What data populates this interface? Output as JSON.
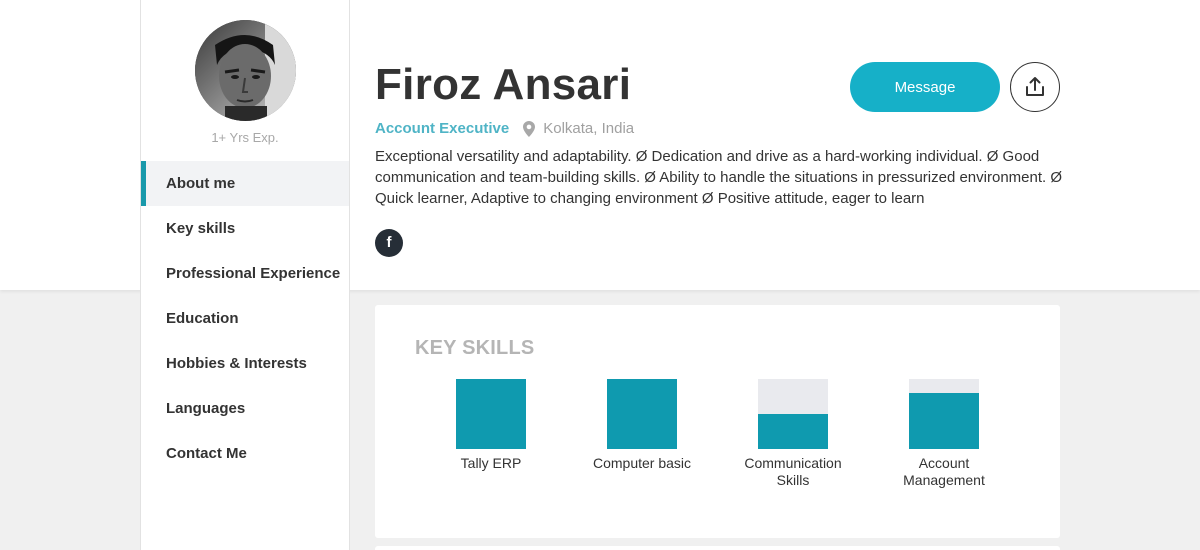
{
  "profile": {
    "name": "Firoz Ansari",
    "job_title": "Account Executive",
    "location": "Kolkata, India",
    "experience": "1+ Yrs Exp.",
    "bio": "Exceptional versatility and adaptability. Ø Dedication and drive as a hard-working individual. Ø Good communication and team-building skills. Ø Ability to handle the situations in pressurized environment. Ø Quick learner, Adaptive to changing environment Ø Positive attitude, eager to learn",
    "facebook_glyph": "f"
  },
  "actions": {
    "message_label": "Message",
    "share_icon": "share-upload-icon"
  },
  "nav": {
    "items": [
      {
        "label": "About me",
        "active": true
      },
      {
        "label": "Key skills"
      },
      {
        "label": "Professional Experience"
      },
      {
        "label": "Education"
      },
      {
        "label": "Hobbies & Interests"
      },
      {
        "label": "Languages"
      },
      {
        "label": "Contact Me"
      }
    ]
  },
  "skills_card": {
    "title": "KEY SKILLS",
    "skills": [
      {
        "label": "Tally ERP",
        "level": 1.0
      },
      {
        "label": "Computer basic",
        "level": 1.0
      },
      {
        "label": "Communication Skills",
        "level": 0.5
      },
      {
        "label": "Account Management",
        "level": 0.8
      }
    ]
  },
  "colors": {
    "accent": "#16b0c8",
    "skill_fill": "#0f9aaf",
    "job_title": "#4fb4c6",
    "active_nav_border": "#1999ab",
    "facebook_bg": "#262e37"
  }
}
